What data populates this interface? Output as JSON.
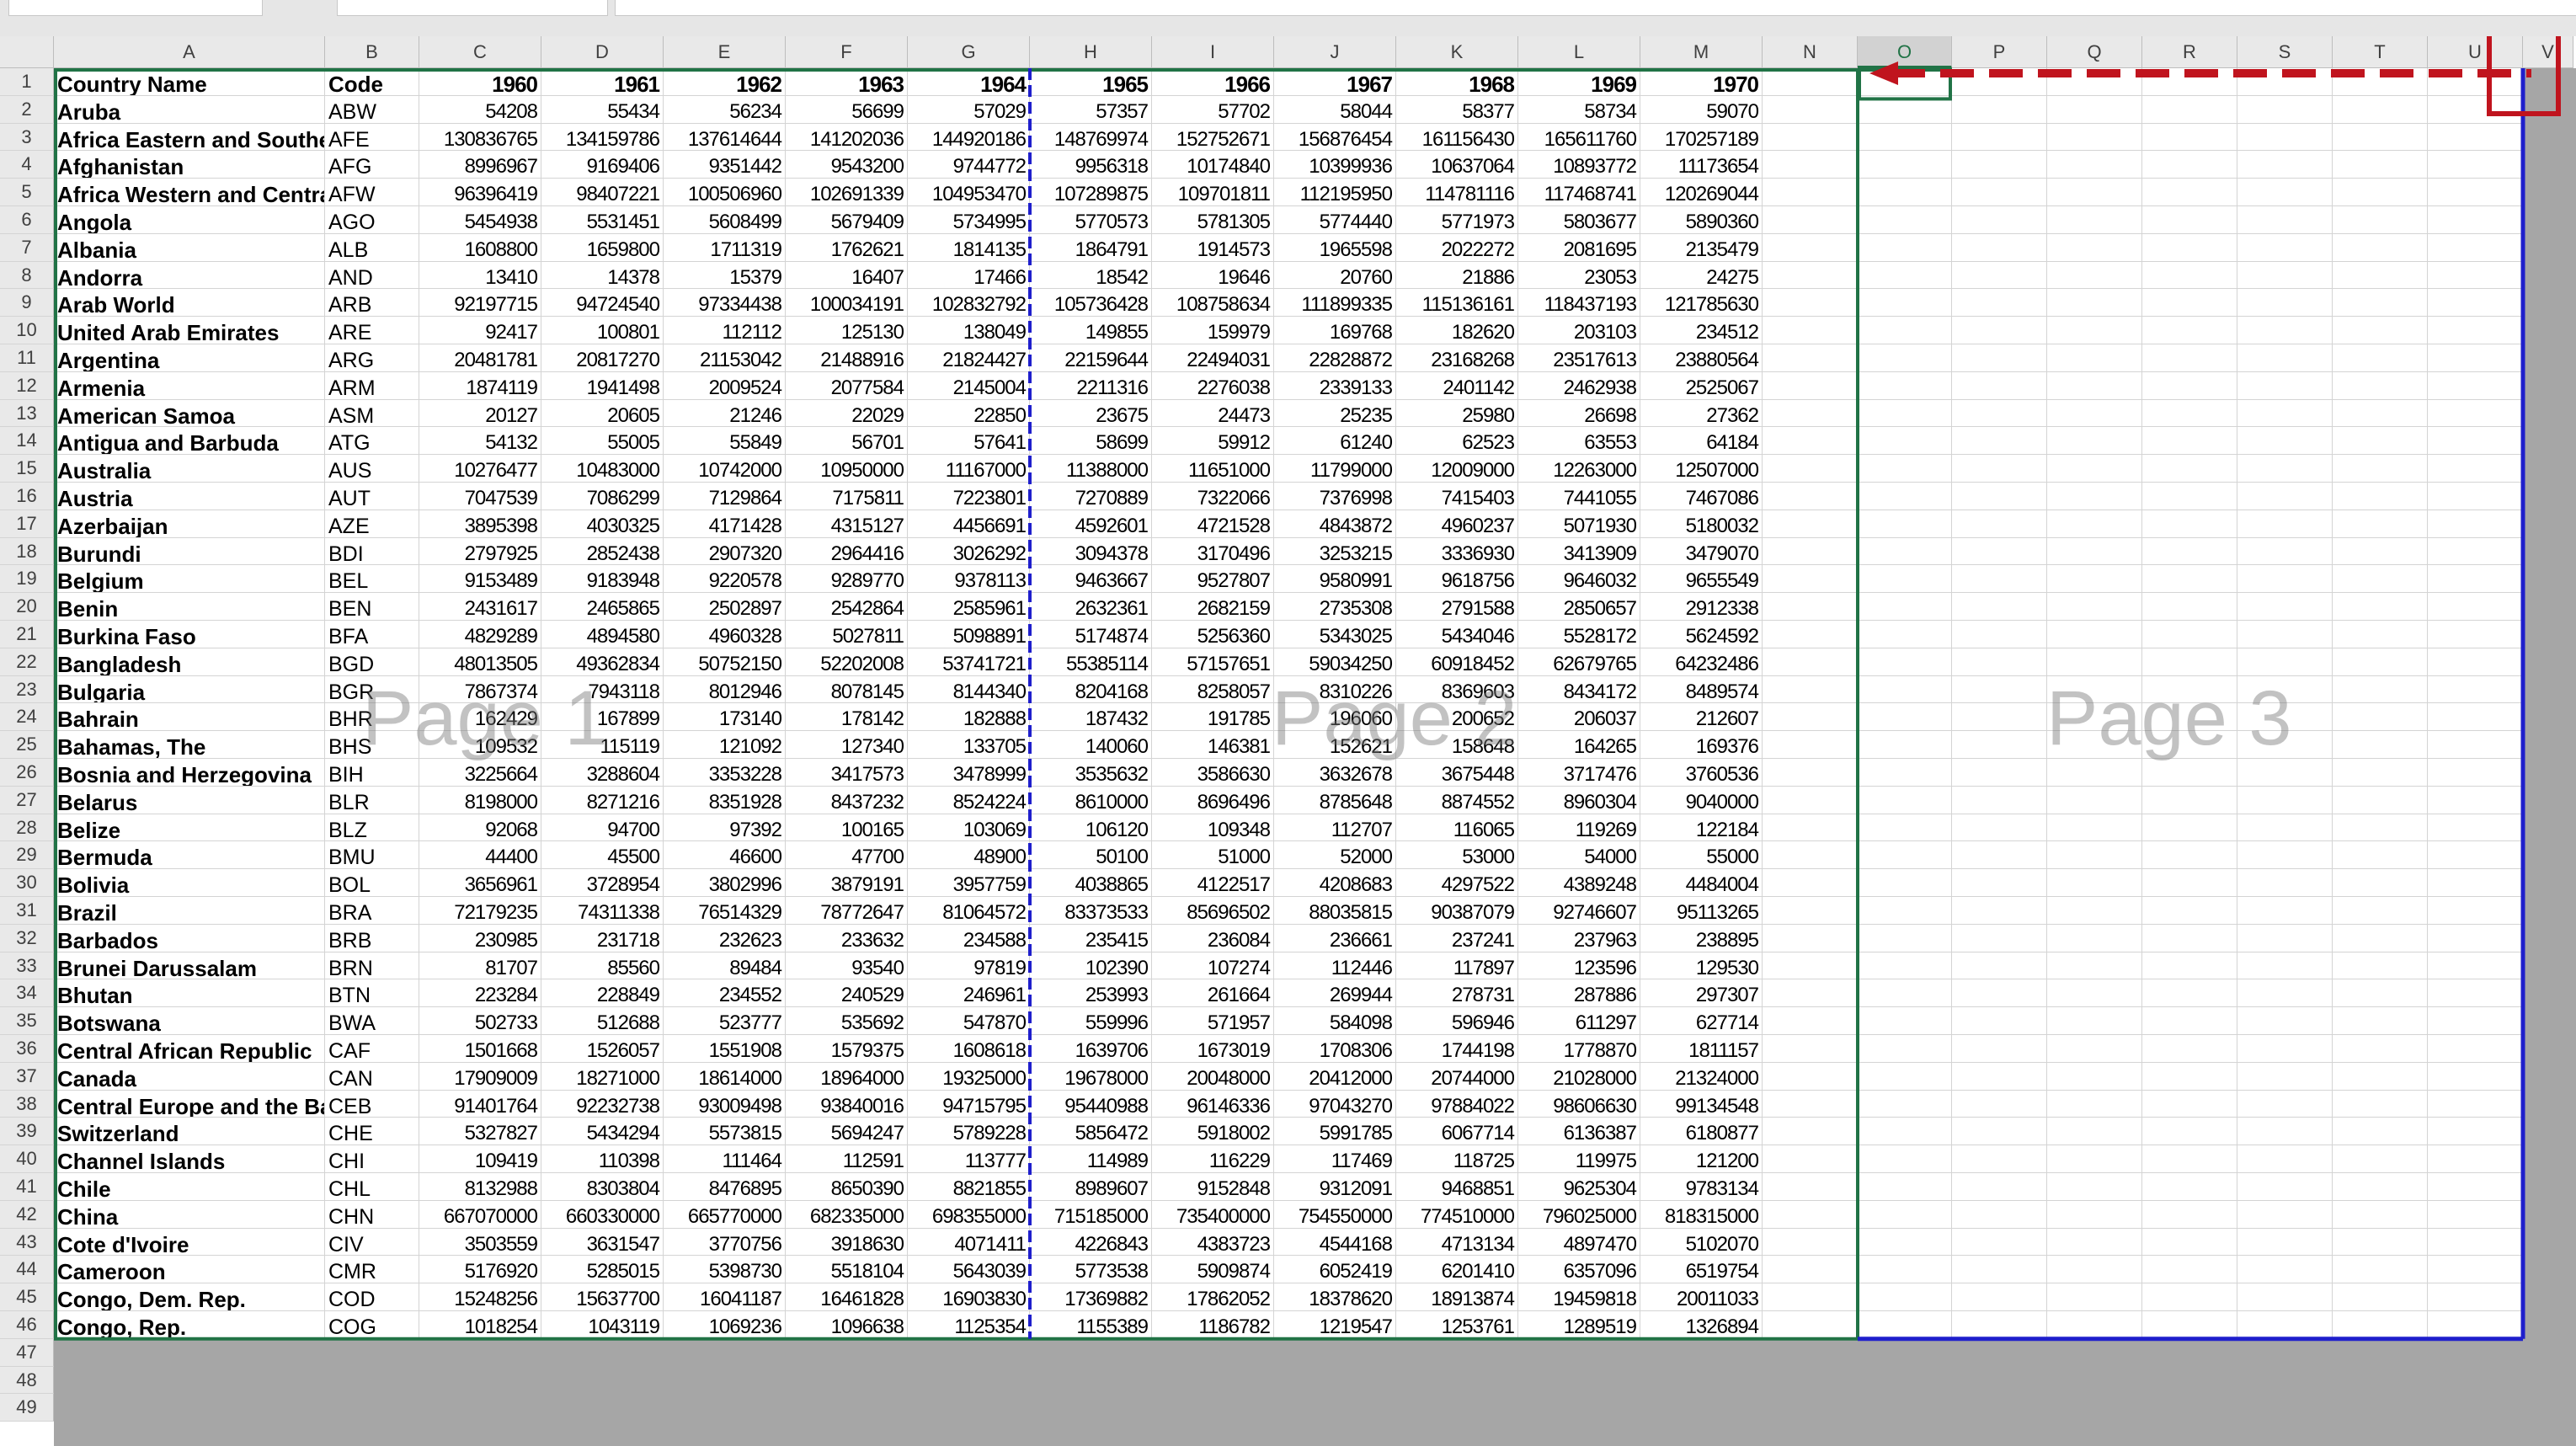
{
  "columns": [
    "A",
    "B",
    "C",
    "D",
    "E",
    "F",
    "G",
    "H",
    "I",
    "J",
    "K",
    "L",
    "M",
    "N",
    "O",
    "P",
    "Q",
    "R",
    "S",
    "T",
    "U",
    "V"
  ],
  "selected_column": "O",
  "row_numbers": [
    "1",
    "2",
    "3",
    "4",
    "5",
    "6",
    "7",
    "8",
    "9",
    "10",
    "11",
    "12",
    "13",
    "14",
    "15",
    "16",
    "17",
    "18",
    "19",
    "20",
    "21",
    "22",
    "23",
    "24",
    "25",
    "26",
    "27",
    "28",
    "29",
    "30",
    "31",
    "32",
    "33",
    "34",
    "35",
    "36",
    "37",
    "38",
    "39",
    "40",
    "41",
    "42",
    "43",
    "44",
    "45",
    "46",
    "47",
    "48",
    "49"
  ],
  "header_row": [
    "Country Name",
    "Code",
    "1960",
    "1961",
    "1962",
    "1963",
    "1964",
    "1965",
    "1966",
    "1967",
    "1968",
    "1969",
    "1970"
  ],
  "rows": [
    [
      "Aruba",
      "ABW",
      "54208",
      "55434",
      "56234",
      "56699",
      "57029",
      "57357",
      "57702",
      "58044",
      "58377",
      "58734",
      "59070"
    ],
    [
      "Africa Eastern and Southern",
      "AFE",
      "130836765",
      "134159786",
      "137614644",
      "141202036",
      "144920186",
      "148769974",
      "152752671",
      "156876454",
      "161156430",
      "165611760",
      "170257189"
    ],
    [
      "Afghanistan",
      "AFG",
      "8996967",
      "9169406",
      "9351442",
      "9543200",
      "9744772",
      "9956318",
      "10174840",
      "10399936",
      "10637064",
      "10893772",
      "11173654"
    ],
    [
      "Africa Western and Central",
      "AFW",
      "96396419",
      "98407221",
      "100506960",
      "102691339",
      "104953470",
      "107289875",
      "109701811",
      "112195950",
      "114781116",
      "117468741",
      "120269044"
    ],
    [
      "Angola",
      "AGO",
      "5454938",
      "5531451",
      "5608499",
      "5679409",
      "5734995",
      "5770573",
      "5781305",
      "5774440",
      "5771973",
      "5803677",
      "5890360"
    ],
    [
      "Albania",
      "ALB",
      "1608800",
      "1659800",
      "1711319",
      "1762621",
      "1814135",
      "1864791",
      "1914573",
      "1965598",
      "2022272",
      "2081695",
      "2135479"
    ],
    [
      "Andorra",
      "AND",
      "13410",
      "14378",
      "15379",
      "16407",
      "17466",
      "18542",
      "19646",
      "20760",
      "21886",
      "23053",
      "24275"
    ],
    [
      "Arab World",
      "ARB",
      "92197715",
      "94724540",
      "97334438",
      "100034191",
      "102832792",
      "105736428",
      "108758634",
      "111899335",
      "115136161",
      "118437193",
      "121785630"
    ],
    [
      "United Arab Emirates",
      "ARE",
      "92417",
      "100801",
      "112112",
      "125130",
      "138049",
      "149855",
      "159979",
      "169768",
      "182620",
      "203103",
      "234512"
    ],
    [
      "Argentina",
      "ARG",
      "20481781",
      "20817270",
      "21153042",
      "21488916",
      "21824427",
      "22159644",
      "22494031",
      "22828872",
      "23168268",
      "23517613",
      "23880564"
    ],
    [
      "Armenia",
      "ARM",
      "1874119",
      "1941498",
      "2009524",
      "2077584",
      "2145004",
      "2211316",
      "2276038",
      "2339133",
      "2401142",
      "2462938",
      "2525067"
    ],
    [
      "American Samoa",
      "ASM",
      "20127",
      "20605",
      "21246",
      "22029",
      "22850",
      "23675",
      "24473",
      "25235",
      "25980",
      "26698",
      "27362"
    ],
    [
      "Antigua and Barbuda",
      "ATG",
      "54132",
      "55005",
      "55849",
      "56701",
      "57641",
      "58699",
      "59912",
      "61240",
      "62523",
      "63553",
      "64184"
    ],
    [
      "Australia",
      "AUS",
      "10276477",
      "10483000",
      "10742000",
      "10950000",
      "11167000",
      "11388000",
      "11651000",
      "11799000",
      "12009000",
      "12263000",
      "12507000"
    ],
    [
      "Austria",
      "AUT",
      "7047539",
      "7086299",
      "7129864",
      "7175811",
      "7223801",
      "7270889",
      "7322066",
      "7376998",
      "7415403",
      "7441055",
      "7467086"
    ],
    [
      "Azerbaijan",
      "AZE",
      "3895398",
      "4030325",
      "4171428",
      "4315127",
      "4456691",
      "4592601",
      "4721528",
      "4843872",
      "4960237",
      "5071930",
      "5180032"
    ],
    [
      "Burundi",
      "BDI",
      "2797925",
      "2852438",
      "2907320",
      "2964416",
      "3026292",
      "3094378",
      "3170496",
      "3253215",
      "3336930",
      "3413909",
      "3479070"
    ],
    [
      "Belgium",
      "BEL",
      "9153489",
      "9183948",
      "9220578",
      "9289770",
      "9378113",
      "9463667",
      "9527807",
      "9580991",
      "9618756",
      "9646032",
      "9655549"
    ],
    [
      "Benin",
      "BEN",
      "2431617",
      "2465865",
      "2502897",
      "2542864",
      "2585961",
      "2632361",
      "2682159",
      "2735308",
      "2791588",
      "2850657",
      "2912338"
    ],
    [
      "Burkina Faso",
      "BFA",
      "4829289",
      "4894580",
      "4960328",
      "5027811",
      "5098891",
      "5174874",
      "5256360",
      "5343025",
      "5434046",
      "5528172",
      "5624592"
    ],
    [
      "Bangladesh",
      "BGD",
      "48013505",
      "49362834",
      "50752150",
      "52202008",
      "53741721",
      "55385114",
      "57157651",
      "59034250",
      "60918452",
      "62679765",
      "64232486"
    ],
    [
      "Bulgaria",
      "BGR",
      "7867374",
      "7943118",
      "8012946",
      "8078145",
      "8144340",
      "8204168",
      "8258057",
      "8310226",
      "8369603",
      "8434172",
      "8489574"
    ],
    [
      "Bahrain",
      "BHR",
      "162429",
      "167899",
      "173140",
      "178142",
      "182888",
      "187432",
      "191785",
      "196060",
      "200652",
      "206037",
      "212607"
    ],
    [
      "Bahamas, The",
      "BHS",
      "109532",
      "115119",
      "121092",
      "127340",
      "133705",
      "140060",
      "146381",
      "152621",
      "158648",
      "164265",
      "169376"
    ],
    [
      "Bosnia and Herzegovina",
      "BIH",
      "3225664",
      "3288604",
      "3353228",
      "3417573",
      "3478999",
      "3535632",
      "3586630",
      "3632678",
      "3675448",
      "3717476",
      "3760536"
    ],
    [
      "Belarus",
      "BLR",
      "8198000",
      "8271216",
      "8351928",
      "8437232",
      "8524224",
      "8610000",
      "8696496",
      "8785648",
      "8874552",
      "8960304",
      "9040000"
    ],
    [
      "Belize",
      "BLZ",
      "92068",
      "94700",
      "97392",
      "100165",
      "103069",
      "106120",
      "109348",
      "112707",
      "116065",
      "119269",
      "122184"
    ],
    [
      "Bermuda",
      "BMU",
      "44400",
      "45500",
      "46600",
      "47700",
      "48900",
      "50100",
      "51000",
      "52000",
      "53000",
      "54000",
      "55000"
    ],
    [
      "Bolivia",
      "BOL",
      "3656961",
      "3728954",
      "3802996",
      "3879191",
      "3957759",
      "4038865",
      "4122517",
      "4208683",
      "4297522",
      "4389248",
      "4484004"
    ],
    [
      "Brazil",
      "BRA",
      "72179235",
      "74311338",
      "76514329",
      "78772647",
      "81064572",
      "83373533",
      "85696502",
      "88035815",
      "90387079",
      "92746607",
      "95113265"
    ],
    [
      "Barbados",
      "BRB",
      "230985",
      "231718",
      "232623",
      "233632",
      "234588",
      "235415",
      "236084",
      "236661",
      "237241",
      "237963",
      "238895"
    ],
    [
      "Brunei Darussalam",
      "BRN",
      "81707",
      "85560",
      "89484",
      "93540",
      "97819",
      "102390",
      "107274",
      "112446",
      "117897",
      "123596",
      "129530"
    ],
    [
      "Bhutan",
      "BTN",
      "223284",
      "228849",
      "234552",
      "240529",
      "246961",
      "253993",
      "261664",
      "269944",
      "278731",
      "287886",
      "297307"
    ],
    [
      "Botswana",
      "BWA",
      "502733",
      "512688",
      "523777",
      "535692",
      "547870",
      "559996",
      "571957",
      "584098",
      "596946",
      "611297",
      "627714"
    ],
    [
      "Central African Republic",
      "CAF",
      "1501668",
      "1526057",
      "1551908",
      "1579375",
      "1608618",
      "1639706",
      "1673019",
      "1708306",
      "1744198",
      "1778870",
      "1811157"
    ],
    [
      "Canada",
      "CAN",
      "17909009",
      "18271000",
      "18614000",
      "18964000",
      "19325000",
      "19678000",
      "20048000",
      "20412000",
      "20744000",
      "21028000",
      "21324000"
    ],
    [
      "Central Europe and the Baltics",
      "CEB",
      "91401764",
      "92232738",
      "93009498",
      "93840016",
      "94715795",
      "95440988",
      "96146336",
      "97043270",
      "97884022",
      "98606630",
      "99134548"
    ],
    [
      "Switzerland",
      "CHE",
      "5327827",
      "5434294",
      "5573815",
      "5694247",
      "5789228",
      "5856472",
      "5918002",
      "5991785",
      "6067714",
      "6136387",
      "6180877"
    ],
    [
      "Channel Islands",
      "CHI",
      "109419",
      "110398",
      "111464",
      "112591",
      "113777",
      "114989",
      "116229",
      "117469",
      "118725",
      "119975",
      "121200"
    ],
    [
      "Chile",
      "CHL",
      "8132988",
      "8303804",
      "8476895",
      "8650390",
      "8821855",
      "8989607",
      "9152848",
      "9312091",
      "9468851",
      "9625304",
      "9783134"
    ],
    [
      "China",
      "CHN",
      "667070000",
      "660330000",
      "665770000",
      "682335000",
      "698355000",
      "715185000",
      "735400000",
      "754550000",
      "774510000",
      "796025000",
      "818315000"
    ],
    [
      "Cote d'Ivoire",
      "CIV",
      "3503559",
      "3631547",
      "3770756",
      "3918630",
      "4071411",
      "4226843",
      "4383723",
      "4544168",
      "4713134",
      "4897470",
      "5102070"
    ],
    [
      "Cameroon",
      "CMR",
      "5176920",
      "5285015",
      "5398730",
      "5518104",
      "5643039",
      "5773538",
      "5909874",
      "6052419",
      "6201410",
      "6357096",
      "6519754"
    ],
    [
      "Congo, Dem. Rep.",
      "COD",
      "15248256",
      "15637700",
      "16041187",
      "16461828",
      "16903830",
      "17369882",
      "17862052",
      "18378620",
      "18913874",
      "19459818",
      "20011033"
    ],
    [
      "Congo, Rep.",
      "COG",
      "1018254",
      "1043119",
      "1069236",
      "1096638",
      "1125354",
      "1155389",
      "1186782",
      "1219547",
      "1253761",
      "1289519",
      "1326894"
    ]
  ],
  "page_labels": [
    "Page 1",
    "Page 2",
    "Page 3"
  ],
  "colors": {
    "accent_green": "#217346",
    "page_break_blue": "#1f1fcc",
    "arrow_red": "#c0141e"
  }
}
